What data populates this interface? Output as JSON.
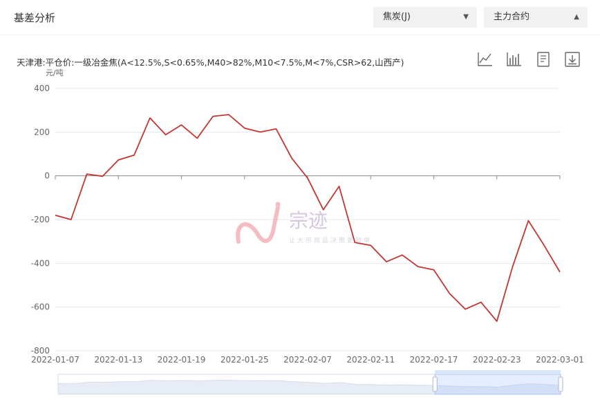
{
  "header": {
    "title": "基差分析",
    "variety_select": {
      "value": "焦炭(J)"
    },
    "contract_select": {
      "value": "主力合约"
    }
  },
  "toolbox": {
    "icons": [
      "line-chart-icon",
      "bar-chart-icon",
      "data-view-icon",
      "download-icon"
    ]
  },
  "watermark": {
    "brand": "宗迹",
    "slogan": "让大宗商品决策更简单"
  },
  "colors": {
    "series": "#c23531",
    "grid": "#e6e6f0",
    "axis": "#666666"
  },
  "chart_data": {
    "type": "line",
    "title": "天津港:平仓价:一级冶金焦(A<12.5%,S<0.65%,M40>82%,M10<7.5%,M<7%,CSR>62,山西产)",
    "ylabel": "元/吨",
    "ylim": [
      -800,
      400
    ],
    "yticks": [
      400,
      200,
      0,
      -200,
      -400,
      -600,
      -800
    ],
    "xtick_labels": [
      "2022-01-07",
      "2022-01-13",
      "2022-01-19",
      "2022-01-25",
      "2022-02-07",
      "2022-02-11",
      "2022-02-17",
      "2022-02-23",
      "2022-03-01"
    ],
    "x": [
      "2022-01-07",
      "2022-01-10",
      "2022-01-11",
      "2022-01-12",
      "2022-01-13",
      "2022-01-14",
      "2022-01-17",
      "2022-01-18",
      "2022-01-19",
      "2022-01-20",
      "2022-01-21",
      "2022-01-24",
      "2022-01-25",
      "2022-01-26",
      "2022-01-27",
      "2022-01-28",
      "2022-02-07",
      "2022-02-08",
      "2022-02-09",
      "2022-02-10",
      "2022-02-11",
      "2022-02-14",
      "2022-02-15",
      "2022-02-16",
      "2022-02-17",
      "2022-02-18",
      "2022-02-21",
      "2022-02-22",
      "2022-02-23",
      "2022-02-24",
      "2022-02-25",
      "2022-02-28",
      "2022-03-01"
    ],
    "series": [
      {
        "values": [
          -180,
          -200,
          8,
          -2,
          73,
          95,
          265,
          188,
          233,
          172,
          272,
          280,
          218,
          200,
          215,
          80,
          -10,
          -155,
          -48,
          -305,
          -318,
          -393,
          -362,
          -415,
          -430,
          -538,
          -610,
          -578,
          -665,
          -415,
          -205,
          -318,
          -440
        ]
      }
    ],
    "grid": true,
    "data_zoom": {
      "start": 0.75,
      "end": 1.0
    }
  }
}
